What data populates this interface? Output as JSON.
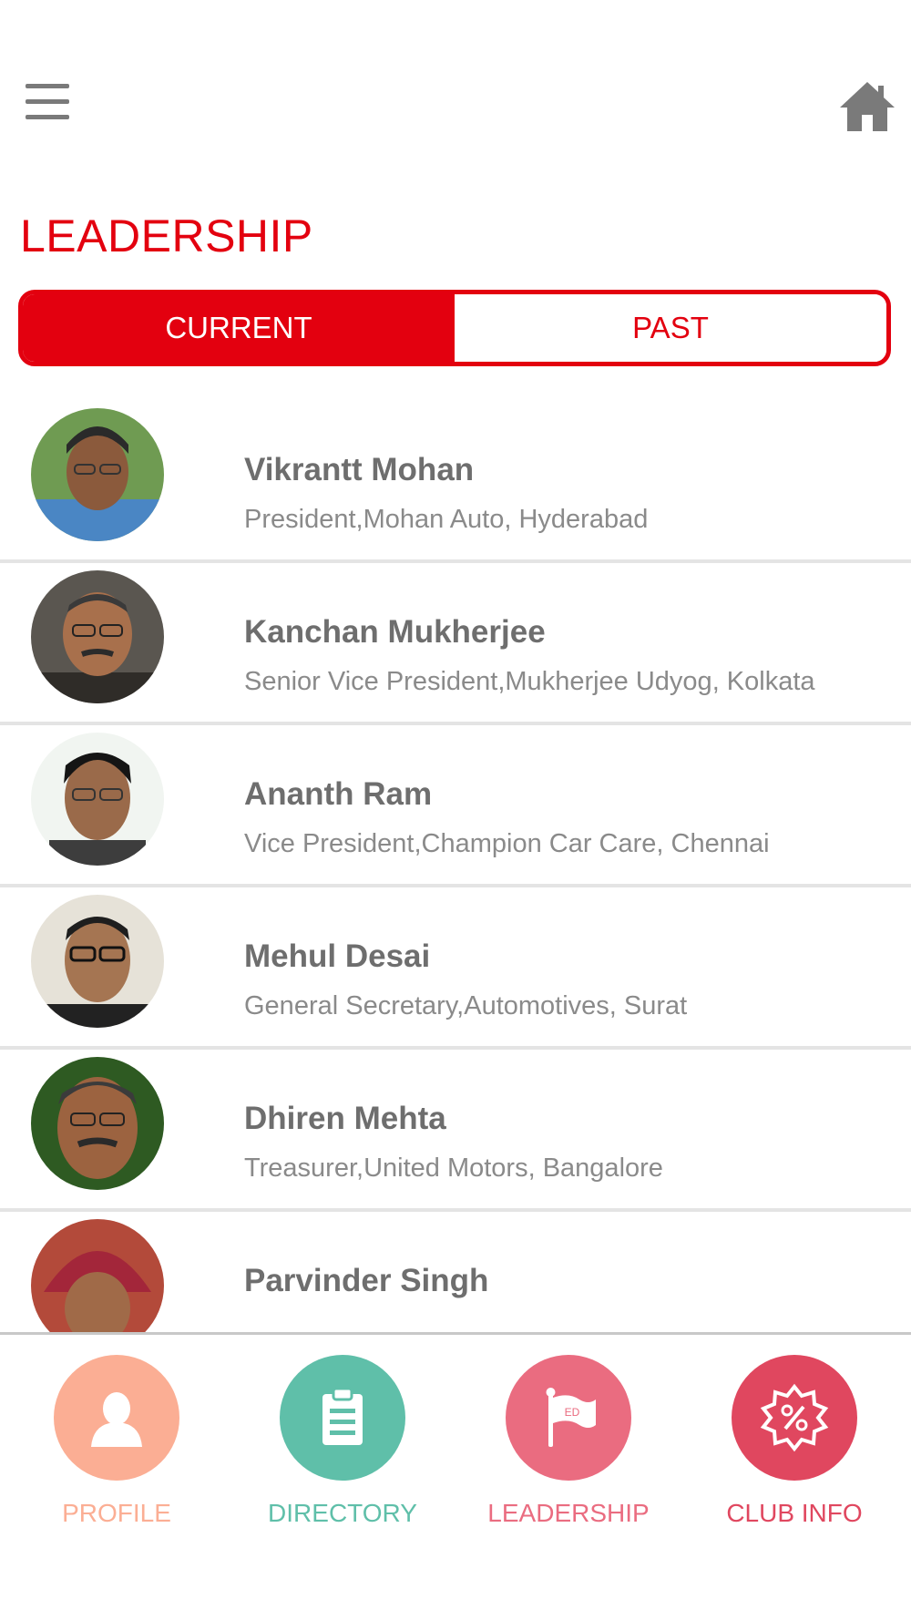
{
  "page": {
    "title": "LEADERSHIP"
  },
  "tabs": {
    "current": "CURRENT",
    "past": "PAST"
  },
  "leaders": [
    {
      "name": "Vikrantt Mohan",
      "subtitle": "President,Mohan Auto, Hyderabad"
    },
    {
      "name": "Kanchan Mukherjee",
      "subtitle": "Senior Vice President,Mukherjee Udyog, Kolkata"
    },
    {
      "name": "Ananth Ram",
      "subtitle": "Vice President,Champion Car Care, Chennai"
    },
    {
      "name": "Mehul Desai",
      "subtitle": "General Secretary,Automotives, Surat"
    },
    {
      "name": "Dhiren Mehta",
      "subtitle": "Treasurer,United Motors, Bangalore"
    },
    {
      "name": "Parvinder Singh",
      "subtitle": ""
    }
  ],
  "nav": {
    "profile": "PROFILE",
    "directory": "DIRECTORY",
    "leadership": "LEADERSHIP",
    "club_info": "CLUB INFO",
    "leadership_flag_text": "ED"
  },
  "colors": {
    "accent": "#e3000f",
    "profile": "#fbae94",
    "directory": "#5fbfa9",
    "leadership": "#ea6c80",
    "club_info": "#e0475f"
  }
}
